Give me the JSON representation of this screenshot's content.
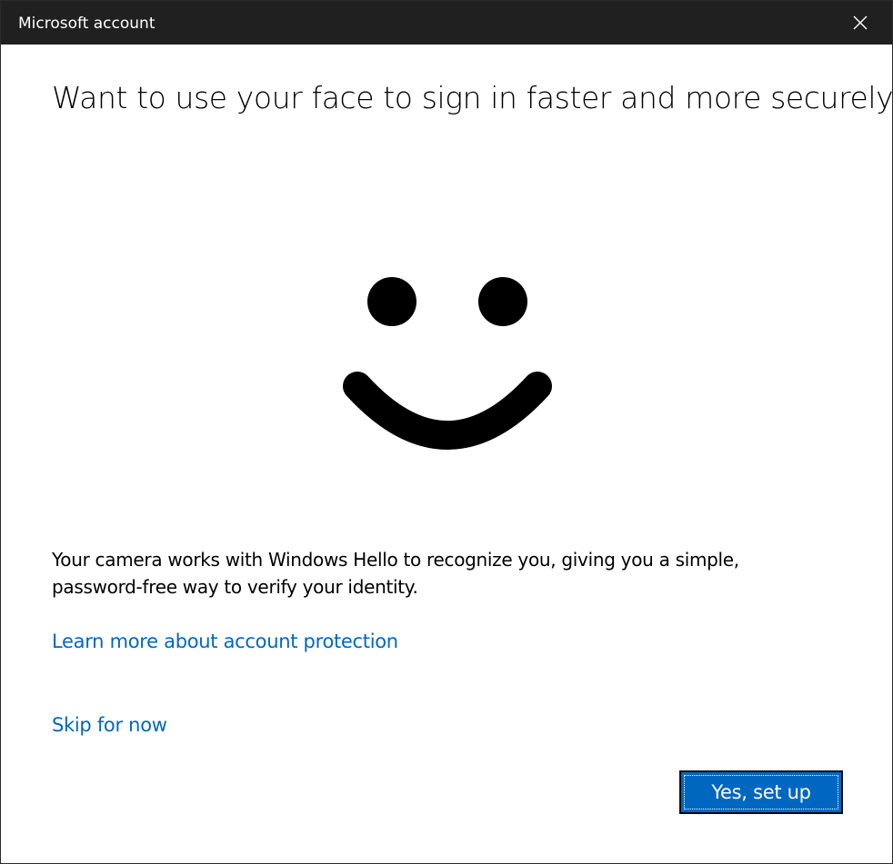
{
  "window": {
    "title": "Microsoft account",
    "close_icon": "close-icon"
  },
  "main": {
    "heading": "Want to use your face to sign in faster and more securely?",
    "illustration_icon": "windows-hello-smiley-icon",
    "description": "Your camera works with Windows Hello to recognize you, giving you a simple, password-free way to verify your identity.",
    "learn_more_link": "Learn more about account protection",
    "skip_link": "Skip for now",
    "primary_button": "Yes, set up"
  },
  "colors": {
    "titlebar": "#202020",
    "link": "#0067c0",
    "primary_button": "#0067c0"
  }
}
